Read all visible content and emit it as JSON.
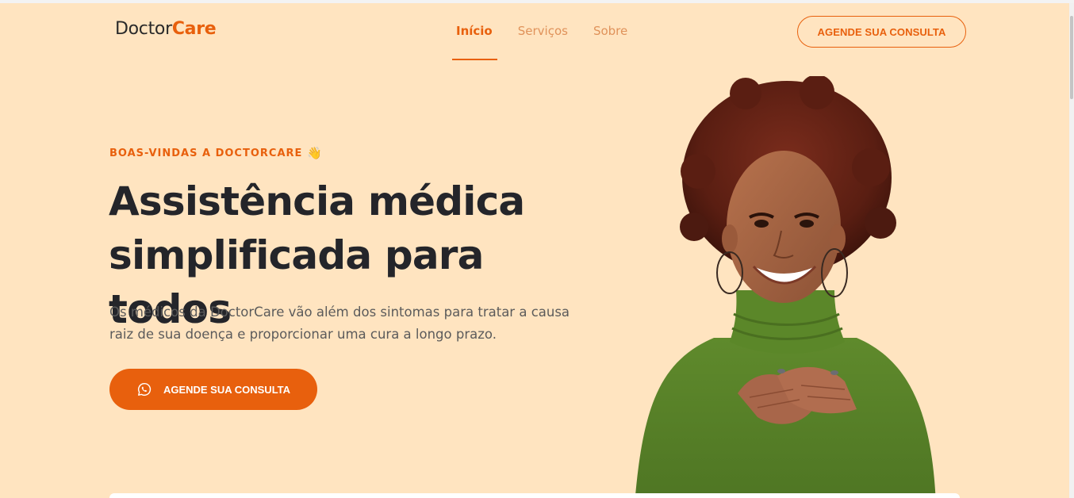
{
  "header": {
    "logo_prefix": "Doctor",
    "logo_accent": "Care",
    "nav": [
      {
        "label": "Início",
        "active": true
      },
      {
        "label": "Serviços",
        "active": false
      },
      {
        "label": "Sobre",
        "active": false
      }
    ],
    "cta": "AGENDE SUA CONSULTA"
  },
  "hero": {
    "eyebrow": "BOAS-VINDAS A DOCTORCARE",
    "eyebrow_emoji": "👋",
    "title_line1": "Assistência médica",
    "title_line2": "simplificada para todos",
    "description": "Os médicos da DoctorCare vão além dos sintomas para tratar a causa raiz de sua doença e proporcionar uma cura a longo prazo.",
    "cta": "AGENDE SUA CONSULTA",
    "cta_icon": "whatsapp-icon",
    "image": "smiling-woman-portrait"
  },
  "colors": {
    "background": "#ffe4c0",
    "accent": "#e8600d",
    "title": "#24252a",
    "text": "#5b5b5b"
  }
}
